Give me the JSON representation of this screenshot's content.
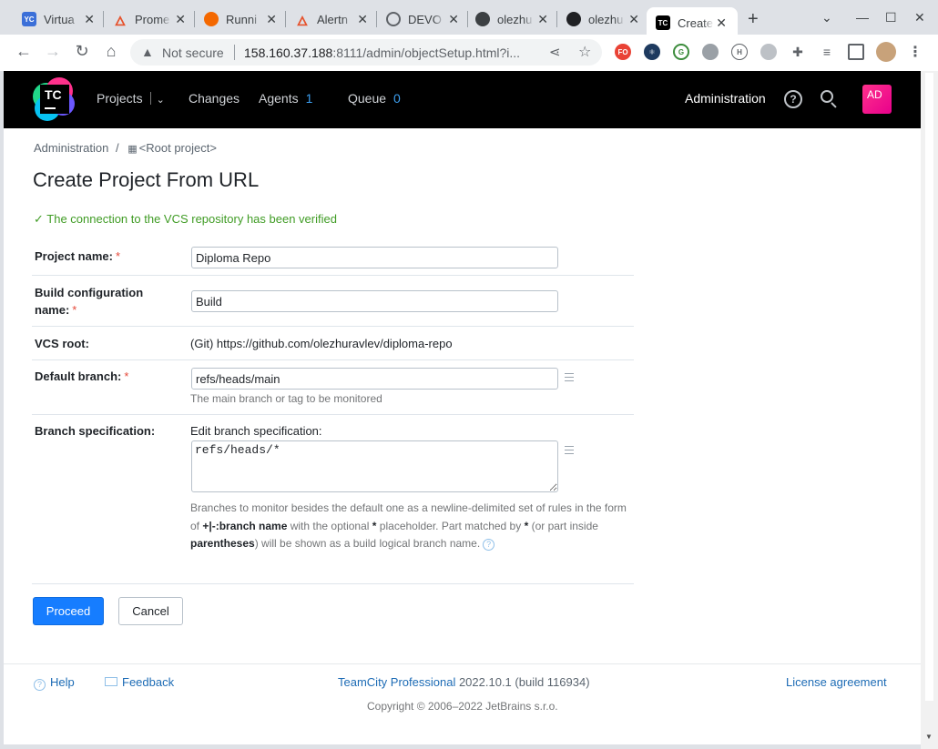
{
  "browser": {
    "tabs": [
      {
        "title": "Virtua",
        "favicon": "YC",
        "color": "#3b6fd8"
      },
      {
        "title": "Prome",
        "favicon": "flame-icon",
        "color": "#e6522c"
      },
      {
        "title": "Runni",
        "favicon": "grafana-icon",
        "color": "#f46800"
      },
      {
        "title": "Alertn",
        "favicon": "flame-icon",
        "color": "#e6522c"
      },
      {
        "title": "DEVO",
        "favicon": "globe-icon",
        "color": "#5f6368"
      },
      {
        "title": "olezhu",
        "favicon": "docker-icon",
        "color": "#3c4043"
      },
      {
        "title": "olezhu",
        "favicon": "github-icon",
        "color": "#202124"
      },
      {
        "title": "Create",
        "favicon": "TC",
        "color": "#000000"
      }
    ],
    "address": {
      "security_label": "Not secure",
      "url_host": "158.160.37.188",
      "url_rest": ":8111/admin/objectSetup.html?i..."
    }
  },
  "header": {
    "logo_text": "TC",
    "nav": {
      "projects": "Projects",
      "changes": "Changes",
      "agents": "Agents",
      "agents_count": "1",
      "queue": "Queue",
      "queue_count": "0"
    },
    "administration": "Administration",
    "avatar_initials": "AD"
  },
  "breadcrumb": {
    "admin": "Administration",
    "separator": "/",
    "root": "<Root project>"
  },
  "page": {
    "title": "Create Project From URL",
    "verified_message": "✓ The connection to the VCS repository has been verified"
  },
  "form": {
    "project_name": {
      "label": "Project name:",
      "value": "Diploma Repo"
    },
    "build_config": {
      "label": "Build configuration name:",
      "value": "Build"
    },
    "vcs_root": {
      "label": "VCS root:",
      "value": "(Git) https://github.com/olezhuravlev/diploma-repo"
    },
    "default_branch": {
      "label": "Default branch:",
      "value": "refs/heads/main",
      "hint": "The main branch or tag to be monitored"
    },
    "branch_spec": {
      "label": "Branch specification:",
      "sublabel": "Edit branch specification:",
      "value": "refs/heads/*",
      "desc_1": "Branches to monitor besides the default one as a newline-delimited set of rules in the form of ",
      "desc_b1": "+|-:branch name",
      "desc_2": " with the optional ",
      "desc_b2": "*",
      "desc_3": " placeholder. Part matched by ",
      "desc_b3": "*",
      "desc_4": " (or part inside ",
      "desc_b4": "parentheses",
      "desc_5": ") will be shown as a build logical branch name."
    },
    "required_mark": "*"
  },
  "actions": {
    "proceed": "Proceed",
    "cancel": "Cancel"
  },
  "footer": {
    "help": "Help",
    "feedback": "Feedback",
    "product": "TeamCity Professional",
    "version": "2022.10.1 (build 116934)",
    "license": "License agreement",
    "copyright": "Copyright © 2006–2022 JetBrains s.r.o."
  }
}
